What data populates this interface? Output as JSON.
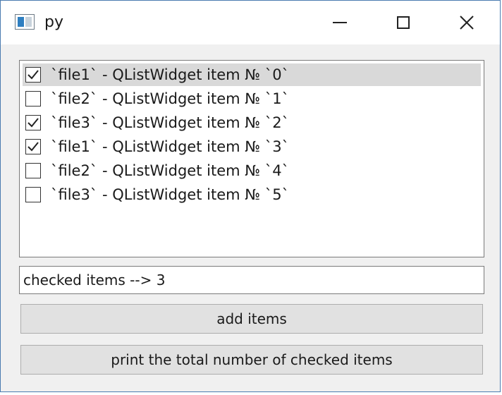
{
  "window": {
    "title": "py"
  },
  "list": {
    "items": [
      {
        "label": "`file1` - QListWidget item № `0`",
        "checked": true,
        "selected": true
      },
      {
        "label": "`file2` - QListWidget item № `1`",
        "checked": false,
        "selected": false
      },
      {
        "label": "`file3` - QListWidget item № `2`",
        "checked": true,
        "selected": false
      },
      {
        "label": "`file1` - QListWidget item № `3`",
        "checked": true,
        "selected": false
      },
      {
        "label": "`file2` - QListWidget item № `4`",
        "checked": false,
        "selected": false
      },
      {
        "label": "`file3` - QListWidget item № `5`",
        "checked": false,
        "selected": false
      }
    ]
  },
  "status": {
    "value": "checked items --> 3"
  },
  "buttons": {
    "add_label": "add items",
    "print_label": "print the total number of checked items"
  },
  "colors": {
    "window_border": "#4a7bb0",
    "selected_row": "#d9d9d9",
    "button_face": "#e1e1e1"
  }
}
